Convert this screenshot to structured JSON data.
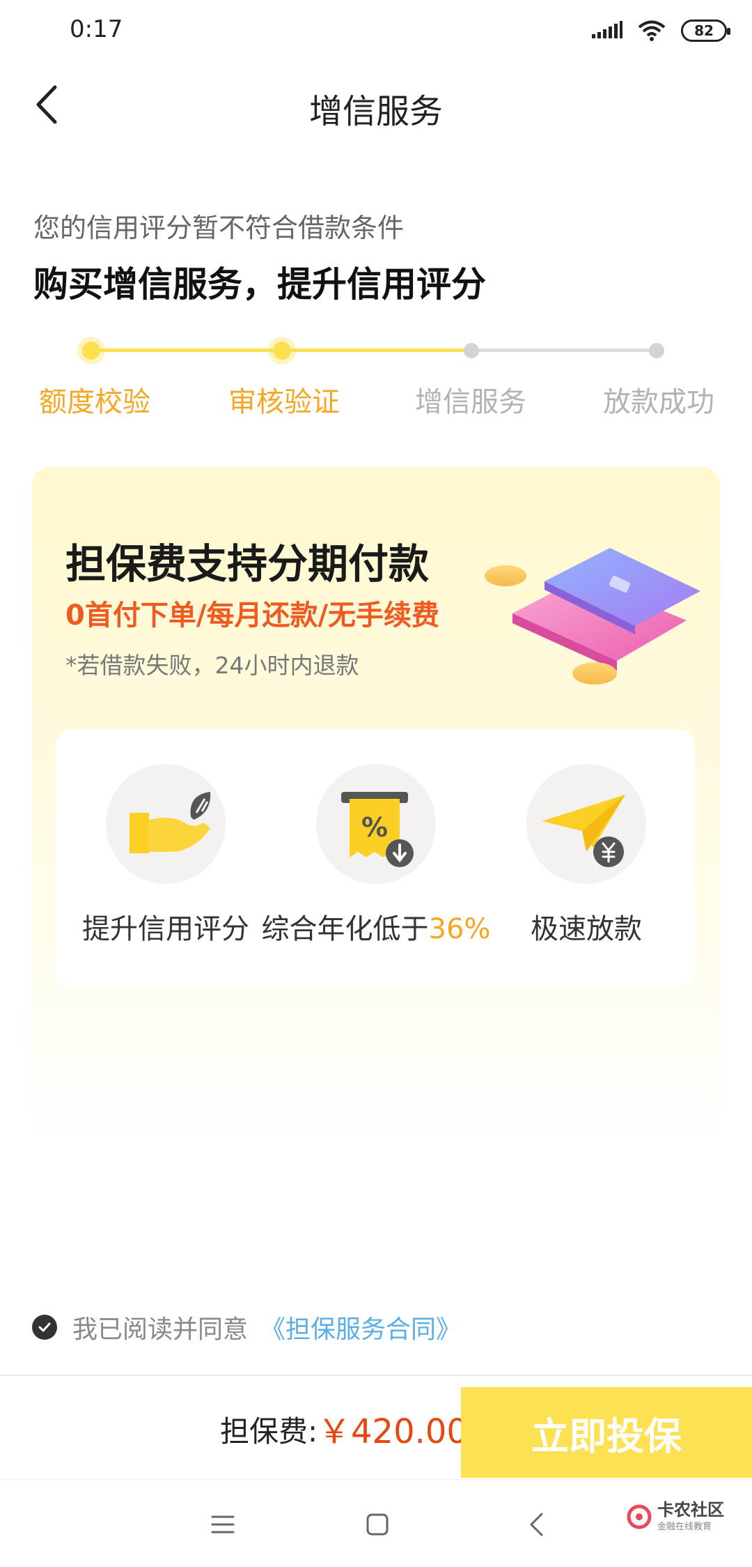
{
  "status_bar": {
    "time": "0:17",
    "battery": "82"
  },
  "header": {
    "title": "增信服务"
  },
  "intro": {
    "subtitle": "您的信用评分暂不符合借款条件",
    "headline": "购买增信服务，提升信用评分"
  },
  "steps": [
    {
      "label": "额度校验",
      "state": "active"
    },
    {
      "label": "审核验证",
      "state": "active"
    },
    {
      "label": "增信服务",
      "state": "inactive"
    },
    {
      "label": "放款成功",
      "state": "inactive"
    }
  ],
  "promo": {
    "title": "担保费支持分期付款",
    "subtitle": "0首付下单/每月还款/无手续费",
    "note": "*若借款失败，24小时内退款"
  },
  "features": [
    {
      "label": "提升信用评分",
      "icon": "hand-with-leaf-icon"
    },
    {
      "label_prefix": "综合年化低于",
      "label_highlight": "36%",
      "icon": "percent-receipt-icon"
    },
    {
      "label": "极速放款",
      "icon": "paper-plane-yuan-icon"
    }
  ],
  "agreement": {
    "text": "我已阅读并同意",
    "link": "《担保服务合同》",
    "checked": true
  },
  "footer": {
    "fee_label": "担保费:",
    "fee_value": "￥420.00",
    "button_label": "立即投保"
  },
  "watermark": {
    "title": "卡农社区",
    "subtitle": "金融在线教育"
  },
  "colors": {
    "accent_yellow": "#fde155",
    "step_active": "#f5a623",
    "price_red": "#e8470f",
    "link_blue": "#5aaee6"
  }
}
